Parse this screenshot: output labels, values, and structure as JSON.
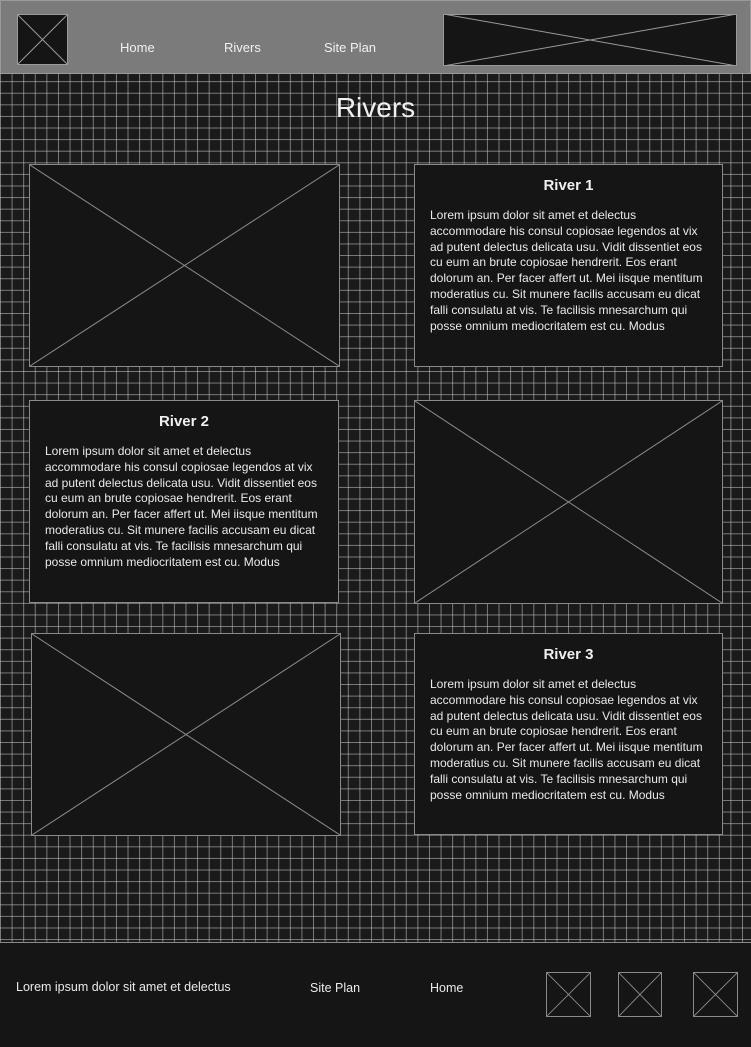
{
  "header": {
    "nav": [
      {
        "label": "Home"
      },
      {
        "label": "Rivers"
      },
      {
        "label": "Site Plan"
      }
    ]
  },
  "page": {
    "title": "Rivers"
  },
  "rivers": [
    {
      "title": "River 1",
      "body": "Lorem ipsum dolor sit amet et delectus accommodare his consul copiosae legendos at vix ad putent delectus delicata usu. Vidit dissentiet eos cu eum an brute copiosae hendrerit. Eos erant dolorum an. Per facer affert ut. Mei iisque mentitum moderatius cu. Sit munere facilis accusam eu dicat falli consulatu at vis. Te facilisis mnesarchum qui posse omnium mediocritatem est cu. Modus"
    },
    {
      "title": "River 2",
      "body": "Lorem ipsum dolor sit amet et delectus accommodare his consul copiosae legendos at vix ad putent delectus delicata usu. Vidit dissentiet eos cu eum an brute copiosae hendrerit. Eos erant dolorum an. Per facer affert ut. Mei iisque mentitum moderatius cu. Sit munere facilis accusam eu dicat falli consulatu at vis. Te facilisis mnesarchum qui posse omnium mediocritatem est cu. Modus"
    },
    {
      "title": "River 3",
      "body": "Lorem ipsum dolor sit amet et delectus accommodare his consul copiosae legendos at vix ad putent delectus delicata usu. Vidit dissentiet eos cu eum an brute copiosae hendrerit. Eos erant dolorum an. Per facer affert ut. Mei iisque mentitum moderatius cu. Sit munere facilis accusam eu dicat falli consulatu at vis. Te facilisis mnesarchum qui posse omnium mediocritatem est cu. Modus"
    }
  ],
  "footer": {
    "text": "Lorem ipsum dolor sit amet et delectus",
    "links": [
      {
        "label": "Site Plan"
      },
      {
        "label": "Home"
      }
    ],
    "social_icons": [
      "image-placeholder-icon",
      "image-placeholder-icon",
      "image-placeholder-icon"
    ]
  },
  "colors": {
    "background": "#1a1a1a",
    "grid": "#cdcdcd",
    "header": "#7b7b7b",
    "panel": "#151515",
    "border": "#8a8a8a",
    "text": "#eaeaea"
  }
}
